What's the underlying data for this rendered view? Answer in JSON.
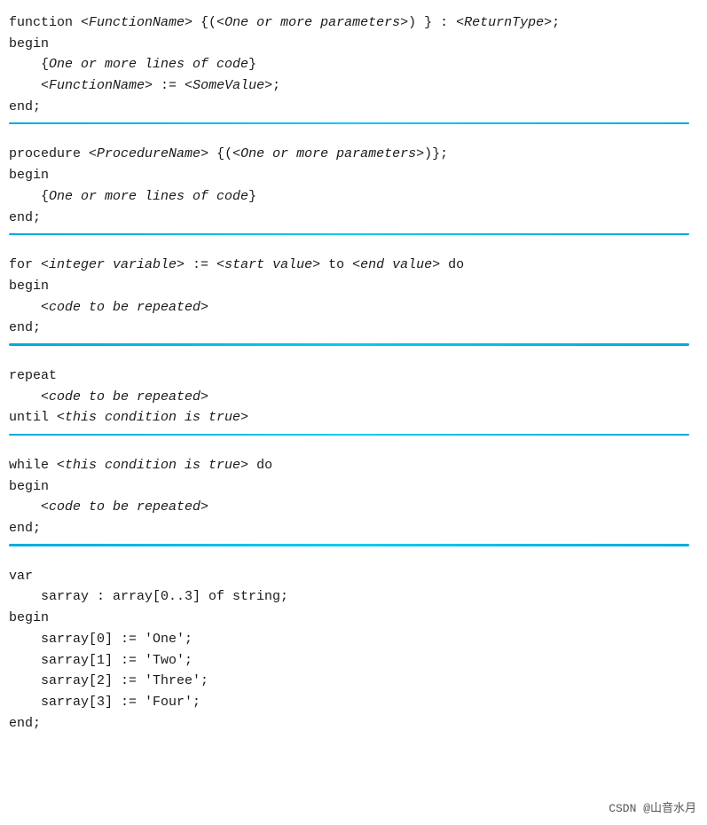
{
  "blocks": [
    {
      "id": "function-block",
      "lines": [
        "function &lt;FunctionName&gt; {(&lt;One or more parameters&gt;) } : &lt;ReturnType&gt;;",
        "begin",
        "    {<i>One or more lines of code</i>}",
        "    &lt;FunctionName&gt; := &lt;SomeValue&gt;;",
        "end;"
      ]
    },
    {
      "id": "procedure-block",
      "lines": [
        "procedure &lt;ProcedureName&gt; {(&lt;One or more parameters&gt;)};",
        "begin",
        "    {<i>One or more lines of code</i>}",
        "end;"
      ]
    },
    {
      "id": "for-block",
      "lines": [
        "for <i>&lt;integer variable&gt;</i> := <i>&lt;start value&gt;</i> to <i>&lt;end value&gt;</i> do",
        "begin",
        "    <i>&lt;code to be repeated&gt;</i>",
        "end;"
      ]
    },
    {
      "id": "repeat-block",
      "lines": [
        "repeat",
        "    <i>&lt;code to be repeated&gt;</i>",
        "until <i>&lt;this condition is true&gt;</i>"
      ]
    },
    {
      "id": "while-block",
      "lines": [
        "while <i>&lt;this condition is true&gt;</i> do",
        "begin",
        "    <i>&lt;code to be repeated&gt;</i>",
        "end;"
      ]
    },
    {
      "id": "var-block",
      "lines": [
        "var",
        "    sarray : array[0..3] of string;",
        "begin",
        "    sarray[0] := 'One';",
        "    sarray[1] := 'Two';",
        "    sarray[2] := 'Three';",
        "    sarray[3] := 'Four';",
        "end;"
      ],
      "last": true
    }
  ],
  "footer": {
    "text": "CSDN @山音水月"
  }
}
